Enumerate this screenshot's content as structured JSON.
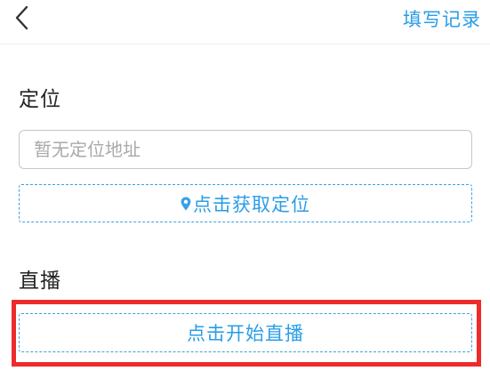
{
  "navbar": {
    "back_icon": "chevron-left-icon",
    "action_label": "填写记录"
  },
  "location": {
    "title": "定位",
    "input_value": "",
    "input_placeholder": "暂无定位地址",
    "get_location_label": "点击获取定位",
    "pin_icon": "location-pin-icon"
  },
  "live": {
    "title": "直播",
    "start_label": "点击开始直播"
  },
  "colors": {
    "accent": "#2a9de8",
    "highlight": "#ee2b2b",
    "title_text": "#222222",
    "placeholder": "#a9a9a9"
  }
}
